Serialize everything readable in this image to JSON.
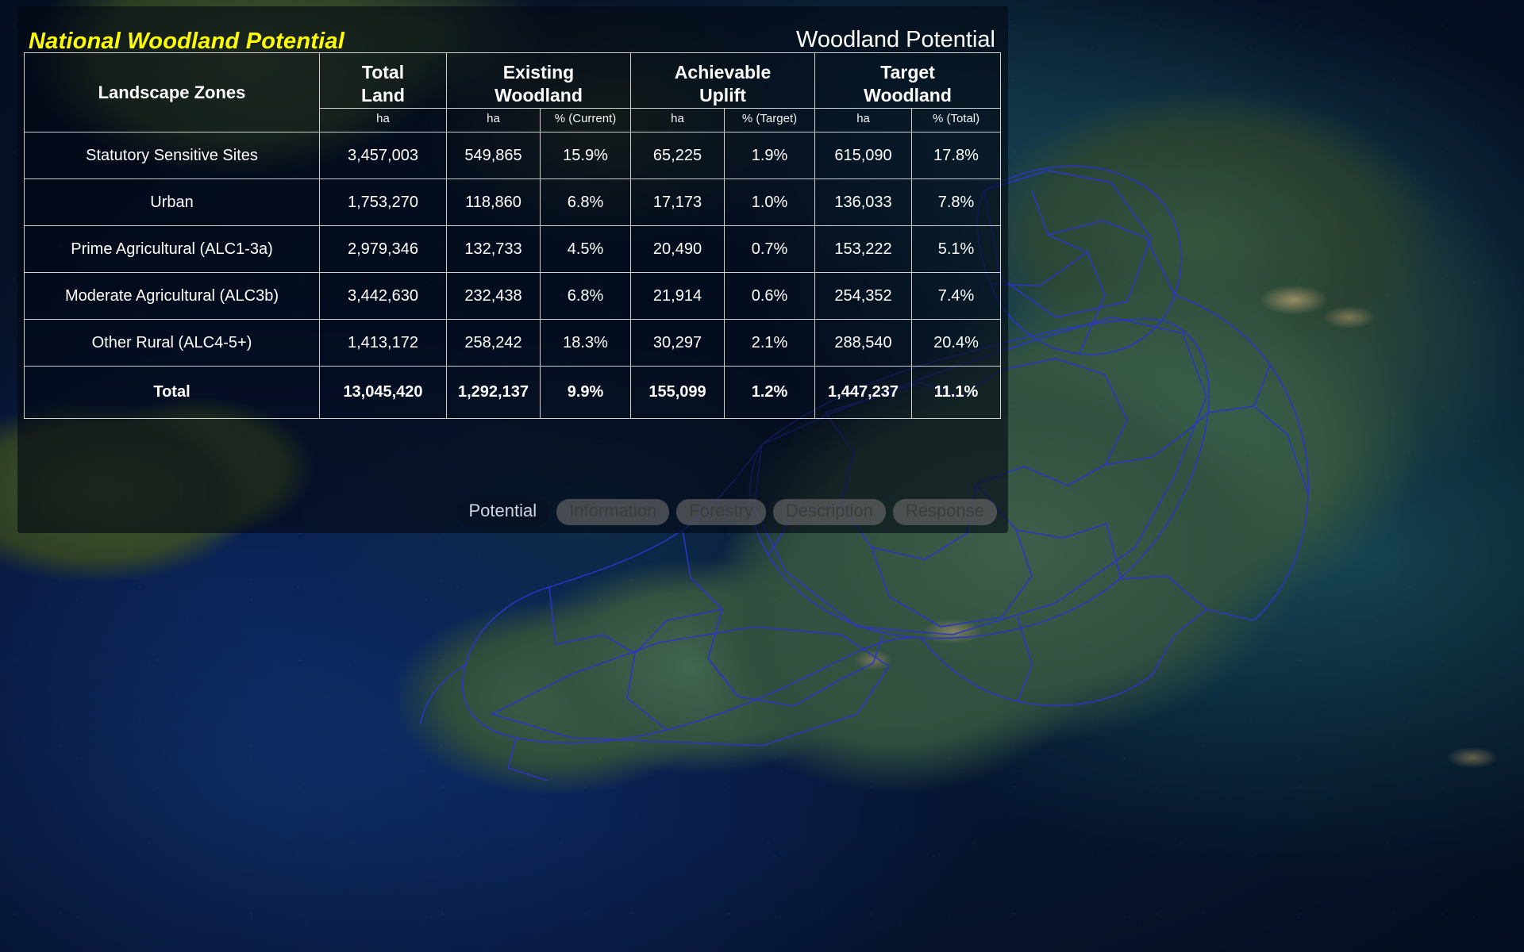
{
  "panel": {
    "title": "National Woodland Potential",
    "subtitle": "Woodland Potential"
  },
  "table": {
    "zone_header": "Landscape Zones",
    "groups": [
      {
        "line1": "Total",
        "line2": "Land",
        "units": [
          "ha"
        ]
      },
      {
        "line1": "Existing",
        "line2": "Woodland",
        "units": [
          "ha",
          "% (Current)"
        ]
      },
      {
        "line1": "Achievable",
        "line2": "Uplift",
        "units": [
          "ha",
          "% (Target)"
        ]
      },
      {
        "line1": "Target",
        "line2": "Woodland",
        "units": [
          "ha",
          "% (Total)"
        ]
      }
    ],
    "rows": [
      {
        "zone": "Statutory Sensitive Sites",
        "total_land": "3,457,003",
        "existing_ha": "549,865",
        "existing_pc": "15.9%",
        "uplift_ha": "65,225",
        "uplift_pc": "1.9%",
        "target_ha": "615,090",
        "target_pc": "17.8%"
      },
      {
        "zone": "Urban",
        "total_land": "1,753,270",
        "existing_ha": "118,860",
        "existing_pc": "6.8%",
        "uplift_ha": "17,173",
        "uplift_pc": "1.0%",
        "target_ha": "136,033",
        "target_pc": "7.8%"
      },
      {
        "zone": "Prime Agricultural (ALC1-3a)",
        "total_land": "2,979,346",
        "existing_ha": "132,733",
        "existing_pc": "4.5%",
        "uplift_ha": "20,490",
        "uplift_pc": "0.7%",
        "target_ha": "153,222",
        "target_pc": "5.1%"
      },
      {
        "zone": "Moderate Agricultural (ALC3b)",
        "total_land": "3,442,630",
        "existing_ha": "232,438",
        "existing_pc": "6.8%",
        "uplift_ha": "21,914",
        "uplift_pc": "0.6%",
        "target_ha": "254,352",
        "target_pc": "7.4%"
      },
      {
        "zone": "Other Rural (ALC4-5+)",
        "total_land": "1,413,172",
        "existing_ha": "258,242",
        "existing_pc": "18.3%",
        "uplift_ha": "30,297",
        "uplift_pc": "2.1%",
        "target_ha": "288,540",
        "target_pc": "20.4%"
      }
    ],
    "total_row": {
      "zone": "Total",
      "total_land": "13,045,420",
      "existing_ha": "1,292,137",
      "existing_pc": "9.9%",
      "uplift_ha": "155,099",
      "uplift_pc": "1.2%",
      "target_ha": "1,447,237",
      "target_pc": "11.1%"
    }
  },
  "tabs": [
    {
      "label": "Potential",
      "active": true
    },
    {
      "label": "Information",
      "active": false
    },
    {
      "label": "Forestry",
      "active": false
    },
    {
      "label": "Description",
      "active": false
    },
    {
      "label": "Response",
      "active": false
    }
  ],
  "colors": {
    "title": "#ffff00",
    "text": "#ffffff",
    "boundary": "#2b35c8",
    "panel_bg": "rgba(4,8,20,0.62)"
  }
}
